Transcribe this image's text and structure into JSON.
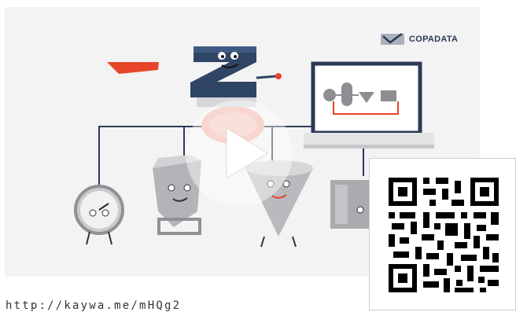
{
  "brand": {
    "logo_text": "COPADATA",
    "logo_color": "#2b3a55",
    "logo_mark_icon": "checkmark-flag-icon"
  },
  "video": {
    "background": "#f3f3f4",
    "play_icon": "play-icon"
  },
  "link": {
    "url_text": "http://kaywa.me/mHQg2"
  },
  "qr": {
    "icon": "qr-code-icon",
    "color": "#000000"
  },
  "colors": {
    "accent_red": "#e8442a",
    "dark_navy": "#2b3a55",
    "metal_gray": "#a7a9ac"
  }
}
